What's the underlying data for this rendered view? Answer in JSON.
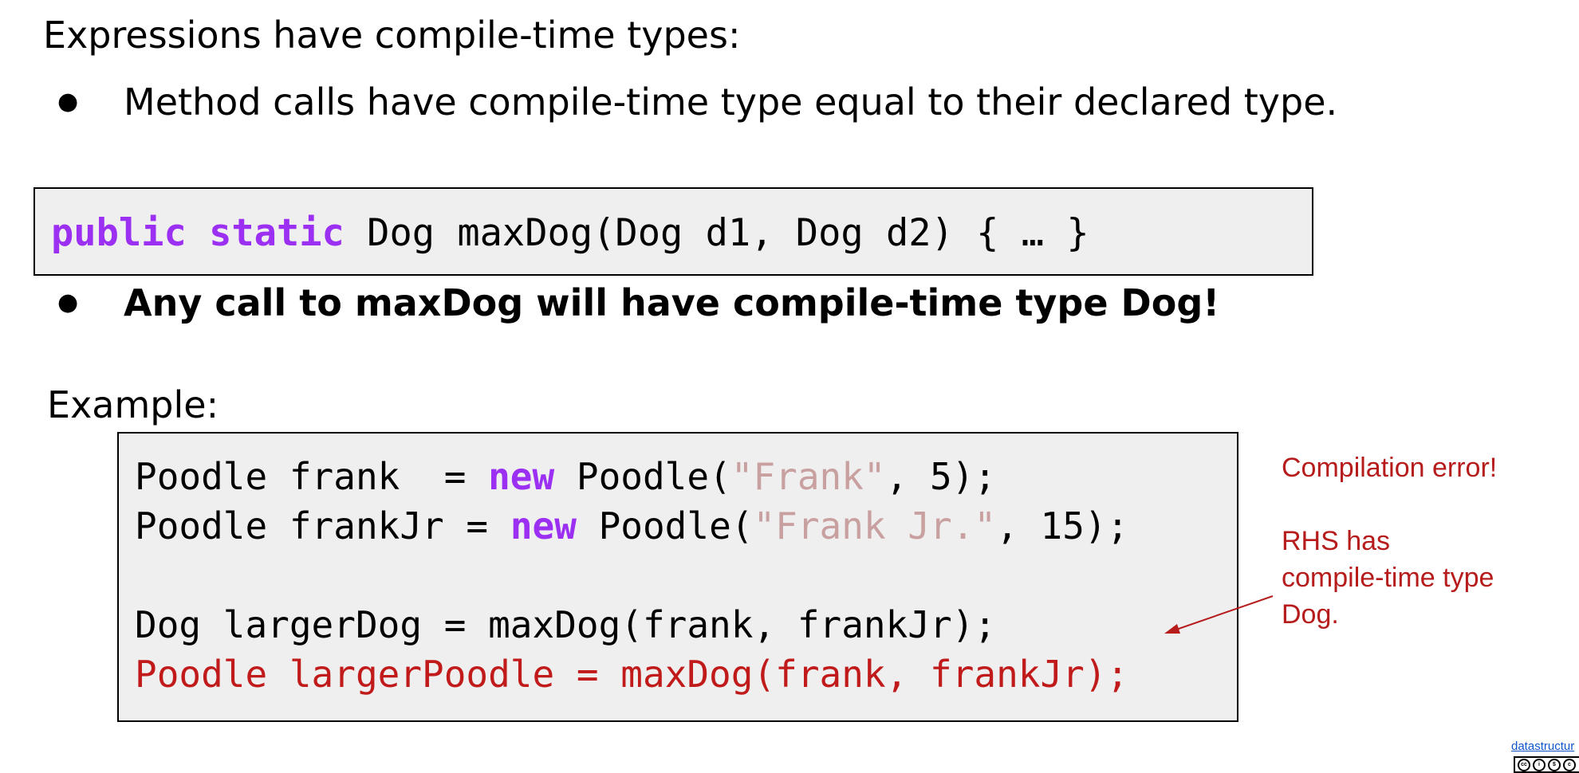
{
  "heading": "Expressions have compile-time types:",
  "bullets": [
    {
      "text": "Method calls have compile-time type equal to their declared type."
    },
    {
      "text": "Any call to maxDog will have compile-time type Dog!"
    }
  ],
  "signature_code": {
    "keyword_public": "public",
    "keyword_static": "static",
    "rest": " Dog maxDog(Dog d1, Dog d2) { … }"
  },
  "example_label": "Example:",
  "example_code": {
    "line1": {
      "prefix": "Poodle frank  = ",
      "keyword": "new",
      "middle": " Poodle(",
      "string": "\"Frank\"",
      "suffix": ", 5);"
    },
    "line2": {
      "prefix": "Poodle frankJr = ",
      "keyword": "new",
      "middle": " Poodle(",
      "string": "\"Frank Jr.\"",
      "suffix": ", 15);"
    },
    "line4": "Dog largerDog = maxDog(frank, frankJr);",
    "line5": "Poodle largerPoodle = maxDog(frank, frankJr);"
  },
  "annotations": {
    "error_title": "Compilation error!",
    "reason_line1": "RHS has",
    "reason_line2": "compile-time type",
    "reason_line3": "Dog."
  },
  "footer": {
    "link_text": "datastructur",
    "license_badge_icons": [
      "cc-icon",
      "by-icon",
      "nc-icon"
    ]
  },
  "colors": {
    "keyword": "#9b30f2",
    "string": "#c9a0a0",
    "error": "#c01a1a",
    "annotation": "#b71c1c",
    "code_background": "#efefef",
    "link": "#1155cc"
  }
}
